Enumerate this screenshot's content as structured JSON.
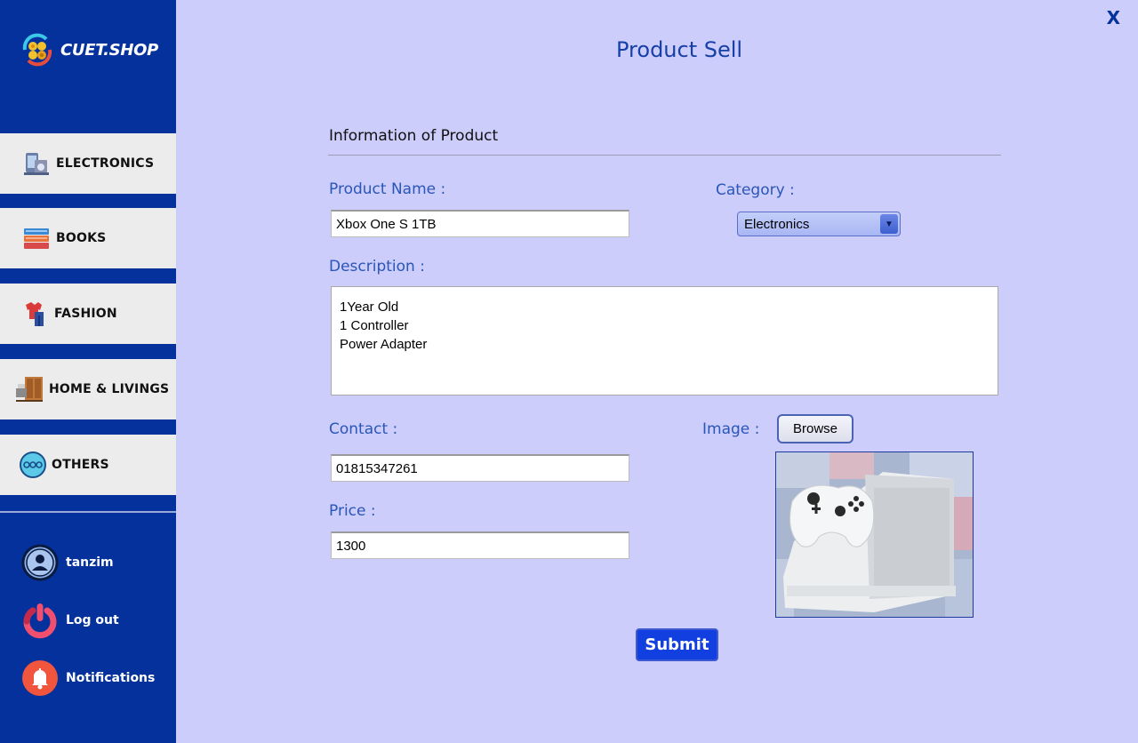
{
  "brand": {
    "name": "CUET.SHOP",
    "icon": "shop-logo-icon"
  },
  "categories": [
    {
      "label": "ELECTRONICS",
      "icon": "electronics-icon"
    },
    {
      "label": "BOOKS",
      "icon": "books-icon"
    },
    {
      "label": "FASHION",
      "icon": "fashion-icon"
    },
    {
      "label": "HOME & LIVINGS",
      "icon": "home-livings-icon"
    },
    {
      "label": "OTHERS",
      "icon": "others-icon"
    }
  ],
  "user_menu": {
    "username": "tanzim",
    "logout": "Log out",
    "notifications": "Notifications"
  },
  "window": {
    "close_label": "X"
  },
  "page": {
    "title": "Product Sell",
    "section_title": "Information of Product"
  },
  "form": {
    "product_name_label": "Product Name :",
    "product_name_value": "Xbox One S 1TB",
    "category_label": "Category :",
    "category_value": "Electronics",
    "description_label": "Description :",
    "description_lines": [
      "1Year Old",
      "1 Controller",
      "Power Adapter"
    ],
    "contact_label": "Contact :",
    "contact_value": "01815347261",
    "image_label": "Image :",
    "browse_label": "Browse",
    "price_label": "Price :",
    "price_value": "1300",
    "submit_label": "Submit"
  },
  "colors": {
    "sidebar": "#04319b",
    "background": "#cccdfb",
    "accent_text": "#2a56b8",
    "submit": "#1240e0"
  }
}
